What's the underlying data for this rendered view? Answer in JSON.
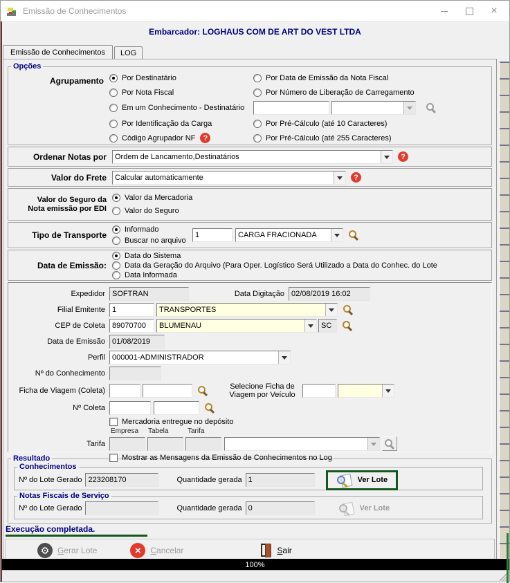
{
  "window": {
    "title": "Emissão de Conhecimentos"
  },
  "header": {
    "embarcador": "Embarcador: LOGHAUS COM DE ART DO VEST LTDA"
  },
  "tabs": [
    {
      "label": "Emissão de Conhecimentos",
      "active": true
    },
    {
      "label": "LOG",
      "active": false
    }
  ],
  "icons": {
    "help_glyph": "?",
    "close_glyph": "×",
    "gear_glyph": "⚙",
    "cancel_glyph": "×"
  },
  "opcoes": {
    "legend": "Opções",
    "agrupamento": {
      "label": "Agrupamento",
      "left": [
        {
          "label": "Por Destinatário",
          "selected": true
        },
        {
          "label": "Por Nota Fiscal",
          "selected": false
        },
        {
          "label": "Em um Conhecimento  -  Destinatário",
          "selected": false
        },
        {
          "label": "Por Identificação da Carga",
          "selected": false
        },
        {
          "label": "Código Agrupador NF",
          "selected": false
        }
      ],
      "right": [
        {
          "label": "Por Data de Emissão da Nota Fiscal",
          "selected": false
        },
        {
          "label": "Por Número de Liberação de Carregamento",
          "selected": false
        },
        {
          "label": "Por Pré-Cálculo (até 10 Caracteres)",
          "selected": false
        },
        {
          "label": "Por Pré-Cálculo (até 255 Caracteres)",
          "selected": false
        }
      ],
      "liberacao_code": "",
      "liberacao_desc": ""
    }
  },
  "ordenar": {
    "label": "Ordenar Notas por",
    "value": "Ordem de Lancamento,Destinatários"
  },
  "frete": {
    "label": "Valor do Frete",
    "value": "Calcular automaticamente"
  },
  "seguro": {
    "label_line1": "Valor do Seguro da",
    "label_line2": "Nota emissão por EDI",
    "options": [
      {
        "label": "Valor da Mercadoria",
        "selected": true
      },
      {
        "label": "Valor do Seguro",
        "selected": false
      }
    ]
  },
  "tipo_transporte": {
    "label": "Tipo de Transporte",
    "options": [
      {
        "label": "Informado",
        "selected": true
      },
      {
        "label": "Buscar no arquivo",
        "selected": false
      }
    ],
    "code": "1",
    "desc": "CARGA FRACIONADA"
  },
  "data_emissao_opts": {
    "label": "Data de Emissão:",
    "options": [
      {
        "label": "Data do Sistema",
        "selected": true
      },
      {
        "label": "Data da Geração do Arquivo (Para Oper. Logístico Será Utilizado a Data do Conhec. do Lote",
        "selected": false
      },
      {
        "label": "Data Informada",
        "selected": false
      }
    ]
  },
  "form": {
    "expedidor": {
      "label": "Expedidor",
      "value": "SOFTRAN"
    },
    "data_digitacao": {
      "label": "Data Digitação",
      "value": "02/08/2019 16:02"
    },
    "filial": {
      "label": "Filial Emitente",
      "code": "1",
      "desc": "TRANSPORTES"
    },
    "cep": {
      "label": "CEP de Coleta",
      "code": "89070700",
      "city": "BLUMENAU",
      "uf": "SC"
    },
    "data_emissao": {
      "label": "Data de Emissão",
      "value": "01/08/2019"
    },
    "perfil": {
      "label": "Perfil",
      "value": "000001-ADMINISTRADOR"
    },
    "n_conhecimento": {
      "label": "Nº do Conhecimento",
      "value": ""
    },
    "ficha_viagem": {
      "label": "Ficha de Viagem (Coleta)",
      "value1": "",
      "value2": ""
    },
    "selecione_ficha": {
      "label_line1": "Selecione Ficha de",
      "label_line2": "Viagem por Veículo",
      "code": "",
      "desc": ""
    },
    "n_coleta": {
      "label": "Nº Coleta",
      "value1": "",
      "value2": ""
    },
    "chk_mercadoria": {
      "label": "Mercadoria entregue no depósito",
      "checked": false
    },
    "tarifa": {
      "label": "Tarifa",
      "headers": [
        "Empresa",
        "Tabela",
        "Tarifa"
      ],
      "empresa": "",
      "tabela": "",
      "tarifa": "",
      "desc": ""
    },
    "chk_mensagens": {
      "label": "Mostrar as Mensagens da Emissão de Conhecimentos no Log",
      "checked": false
    }
  },
  "resultado": {
    "legend": "Resultado",
    "conhecimentos": {
      "legend": "Conhecimentos",
      "lote_label": "Nº do Lote Gerado",
      "lote": "223208170",
      "qtd_label": "Quantidade gerada",
      "qtd": "1",
      "ver_lote": "Ver Lote",
      "enabled": true
    },
    "nfs": {
      "legend": "Notas Fiscais de Serviço",
      "lote_label": "Nº do Lote Gerado",
      "lote": "",
      "qtd_label": "Quantidade gerada",
      "qtd": "0",
      "ver_lote": "Ver Lote",
      "enabled": false
    }
  },
  "status": {
    "message": "Execução completada."
  },
  "actions": {
    "gerar": {
      "key": "G",
      "rest": "erar Lote",
      "enabled": false
    },
    "cancelar": {
      "key": "C",
      "rest": "ancelar",
      "enabled": false
    },
    "sair": {
      "key": "S",
      "rest": "air",
      "enabled": true
    }
  },
  "progress": {
    "value": "100%"
  },
  "colors": {
    "navy": "#000080",
    "field_yellow": "#ffffe1",
    "annotation_green": "#15561c",
    "help_red": "#e23b2e"
  }
}
